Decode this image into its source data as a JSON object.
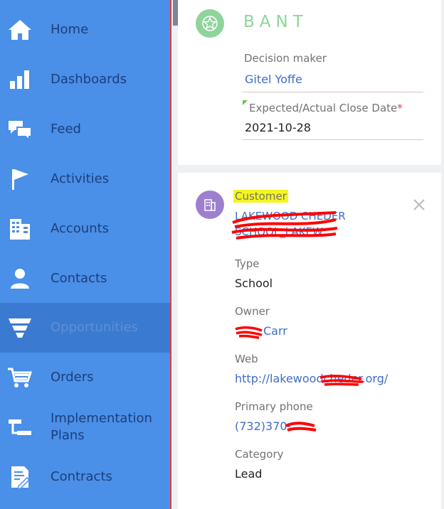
{
  "sidebar": {
    "items": [
      {
        "label": "Home",
        "icon": "home-icon"
      },
      {
        "label": "Dashboards",
        "icon": "bar-chart-icon"
      },
      {
        "label": "Feed",
        "icon": "chat-bubbles-icon"
      },
      {
        "label": "Activities",
        "icon": "flag-icon"
      },
      {
        "label": "Accounts",
        "icon": "building-icon"
      },
      {
        "label": "Contacts",
        "icon": "person-icon"
      },
      {
        "label": "Opportunities",
        "icon": "funnel-icon",
        "active": true
      },
      {
        "label": "Orders",
        "icon": "cart-icon"
      },
      {
        "label": "Implementation Plans",
        "icon": "plans-icon"
      },
      {
        "label": "Contracts",
        "icon": "contract-icon"
      }
    ]
  },
  "bant": {
    "title": "BANT",
    "decision_maker_label": "Decision maker",
    "decision_maker_value": "Gitel Yoffe",
    "close_date_label": "Expected/Actual Close Date",
    "required_marker": "*",
    "close_date_value": "2021-10-28"
  },
  "customer": {
    "label": "Customer",
    "name_line1": "LAKEWOOD CHEDER",
    "name_line2": "SCHOOL_LAKEW",
    "type_label": "Type",
    "type_value": "School",
    "owner_label": "Owner",
    "owner_value": "Carr",
    "web_label": "Web",
    "web_value": "http://lakewoodcheder.org/",
    "phone_label": "Primary phone",
    "phone_value": "(732)370-",
    "category_label": "Category",
    "category_value": "Lead"
  },
  "colors": {
    "sidebar_bg": "#4a8fe8",
    "sidebar_active": "#3b7ad1",
    "nav_text": "#1d3f7a",
    "bant_green": "#8fd49b",
    "customer_purple": "#9d7fcf",
    "link_blue": "#3f6dc6",
    "highlight_yellow": "#f5f51b",
    "redaction_red": "#ff0000"
  }
}
